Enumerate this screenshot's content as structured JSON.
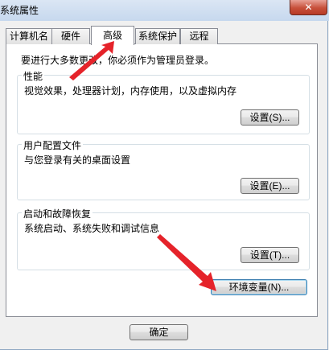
{
  "window": {
    "title": "系统属性",
    "close_glyph": "✕"
  },
  "tabs": [
    "计算机名",
    "硬件",
    "高级",
    "系统保护",
    "远程"
  ],
  "active_tab": "高级",
  "admin_note": "要进行大多数更改，你必须作为管理员登录。",
  "performance": {
    "legend": "性能",
    "description": "视觉效果，处理器计划，内存使用，以及虚拟内存",
    "button": "设置(S)..."
  },
  "user_profiles": {
    "legend": "用户配置文件",
    "description": "与您登录有关的桌面设置",
    "button": "设置(E)..."
  },
  "startup_recovery": {
    "legend": "启动和故障恢复",
    "description": "系统启动、系统失败和调试信息",
    "button": "设置(T)..."
  },
  "env_button": "环境变量(N)...",
  "ok_button": "确定",
  "colors": {
    "annotation_arrow": "#e5232a",
    "titlebar": "#c6d8ee",
    "close_button": "#c7503a"
  }
}
